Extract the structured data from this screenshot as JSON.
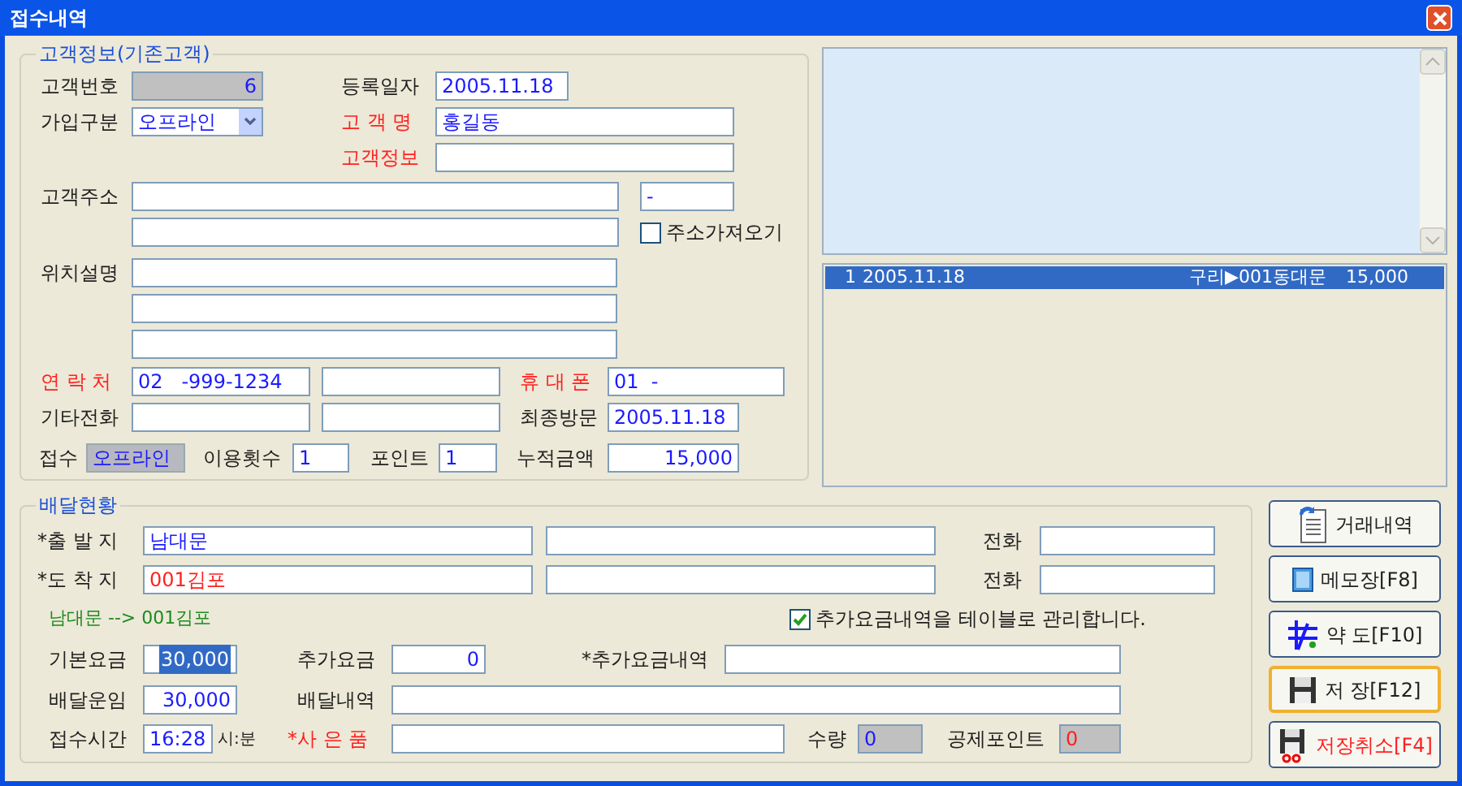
{
  "window": {
    "title": "접수내역"
  },
  "customer": {
    "legend": "고객정보(기존고객)",
    "customer_no": {
      "label": "고객번호",
      "value": "6"
    },
    "registered": {
      "label": "등록일자",
      "value": "2005.11.18"
    },
    "join_type": {
      "label": "가입구분",
      "value": "오프라인"
    },
    "name": {
      "label": "고 객 명",
      "value": "홍길동",
      "required": true
    },
    "info": {
      "label": "고객정보",
      "required": true
    },
    "address": {
      "label": "고객주소",
      "postcode": "-"
    },
    "fetch_address": {
      "label": "주소가져오기",
      "checked": false
    },
    "location": {
      "label": "위치설명"
    },
    "contact": {
      "label": "연 락 처",
      "value": "02   -999-1234",
      "required": true
    },
    "mobile": {
      "label": "휴 대 폰",
      "value": "01  -",
      "required": true
    },
    "other_phone": {
      "label": "기타전화"
    },
    "last_visit": {
      "label": "최종방문",
      "value": "2005.11.18"
    },
    "channel": {
      "label": "접수",
      "value": "오프라인"
    },
    "visits": {
      "label": "이용횟수",
      "value": "1"
    },
    "points": {
      "label": "포인트",
      "value": "1"
    },
    "total": {
      "label": "누적금액",
      "value": "15,000"
    }
  },
  "history": {
    "rows": [
      {
        "no": "1",
        "date": "2005.11.18",
        "route": "구리▶001동대문",
        "amount": "15,000",
        "selected": true
      }
    ]
  },
  "delivery": {
    "legend": "배달현황",
    "departure": {
      "label": "*출 발 지",
      "value": "남대문",
      "phone_label": "전화"
    },
    "arrival": {
      "label": "*도 착 지",
      "value": "001김포",
      "phone_label": "전화"
    },
    "route": "남대문 --> 001김포",
    "extra_table": {
      "label": "추가요금내역을 테이블로 관리합니다.",
      "checked": true
    },
    "base_fee": {
      "label": "기본요금",
      "value": "30,000",
      "selected": true
    },
    "extra_fee": {
      "label": "추가요금",
      "value": "0"
    },
    "extra_detail": {
      "label": "*추가요금내역"
    },
    "delivery_fee": {
      "label": "배달운임",
      "value": "30,000",
      "selected": false
    },
    "delivery_detail": {
      "label": "배달내역"
    },
    "time": {
      "label": "접수시간",
      "value": "16:28",
      "unit": "시:분"
    },
    "gift": {
      "label": "*사 은 품",
      "required": true
    },
    "quantity": {
      "label": "수량",
      "value": "0"
    },
    "deduct_points": {
      "label": "공제포인트",
      "value": "0"
    }
  },
  "buttons": [
    {
      "label": "거래내역",
      "kind": "history",
      "focused": false
    },
    {
      "label": "메모장[F8]",
      "kind": "memo",
      "focused": false
    },
    {
      "label": "약 도[F10]",
      "kind": "map",
      "focused": false
    },
    {
      "label": "저 장[F12]",
      "kind": "save",
      "focused": true
    },
    {
      "label": "저장취소[F4]",
      "kind": "cancel",
      "focused": false
    }
  ]
}
